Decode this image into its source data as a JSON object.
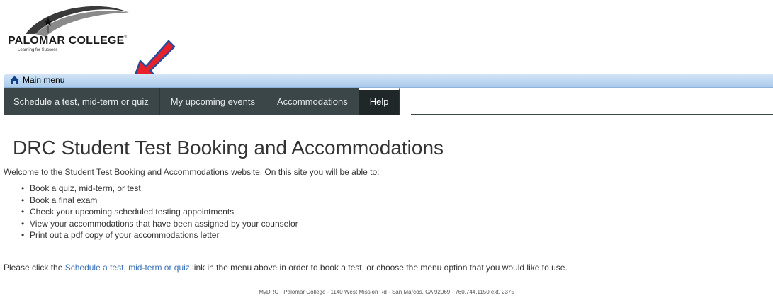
{
  "logo": {
    "name": "PALOMAR COLLEGE",
    "trademark": "®",
    "tagline": "Learning for Success"
  },
  "main_menu": {
    "label": "Main menu",
    "icon": "home-icon"
  },
  "nav": {
    "items": [
      {
        "label": "Schedule a test, mid-term or quiz"
      },
      {
        "label": "My upcoming events"
      },
      {
        "label": "Accommodations"
      },
      {
        "label": "Help",
        "active": true
      }
    ]
  },
  "content": {
    "title": "DRC Student Test Booking and Accommodations",
    "intro": "Welcome to the Student Test Booking and Accommodations website. On this site you will be able to:",
    "bullets": [
      "Book a quiz, mid-term, or test",
      "Book a final exam",
      "Check your upcoming scheduled testing appointments",
      "View your accommodations that have been assigned by your counselor",
      "Print out a pdf copy of your accommodations letter"
    ],
    "instructions": {
      "before": "Please click the ",
      "link": "Schedule a test, mid-term or quiz",
      "after": " link in the menu above in order to book a test, or choose the menu option that you would like to use."
    }
  },
  "footer": {
    "text": "MyDRC - Palomar College - 1140 West Mission Rd - San Marcos, CA 92069 - 760.744.1150 ext. 2375"
  },
  "colors": {
    "nav_bg": "#3b4649",
    "nav_active_bg": "#1f2729",
    "link": "#3d74b6",
    "arrow": "#e8202a",
    "menu_bar": "#a9caeb"
  }
}
